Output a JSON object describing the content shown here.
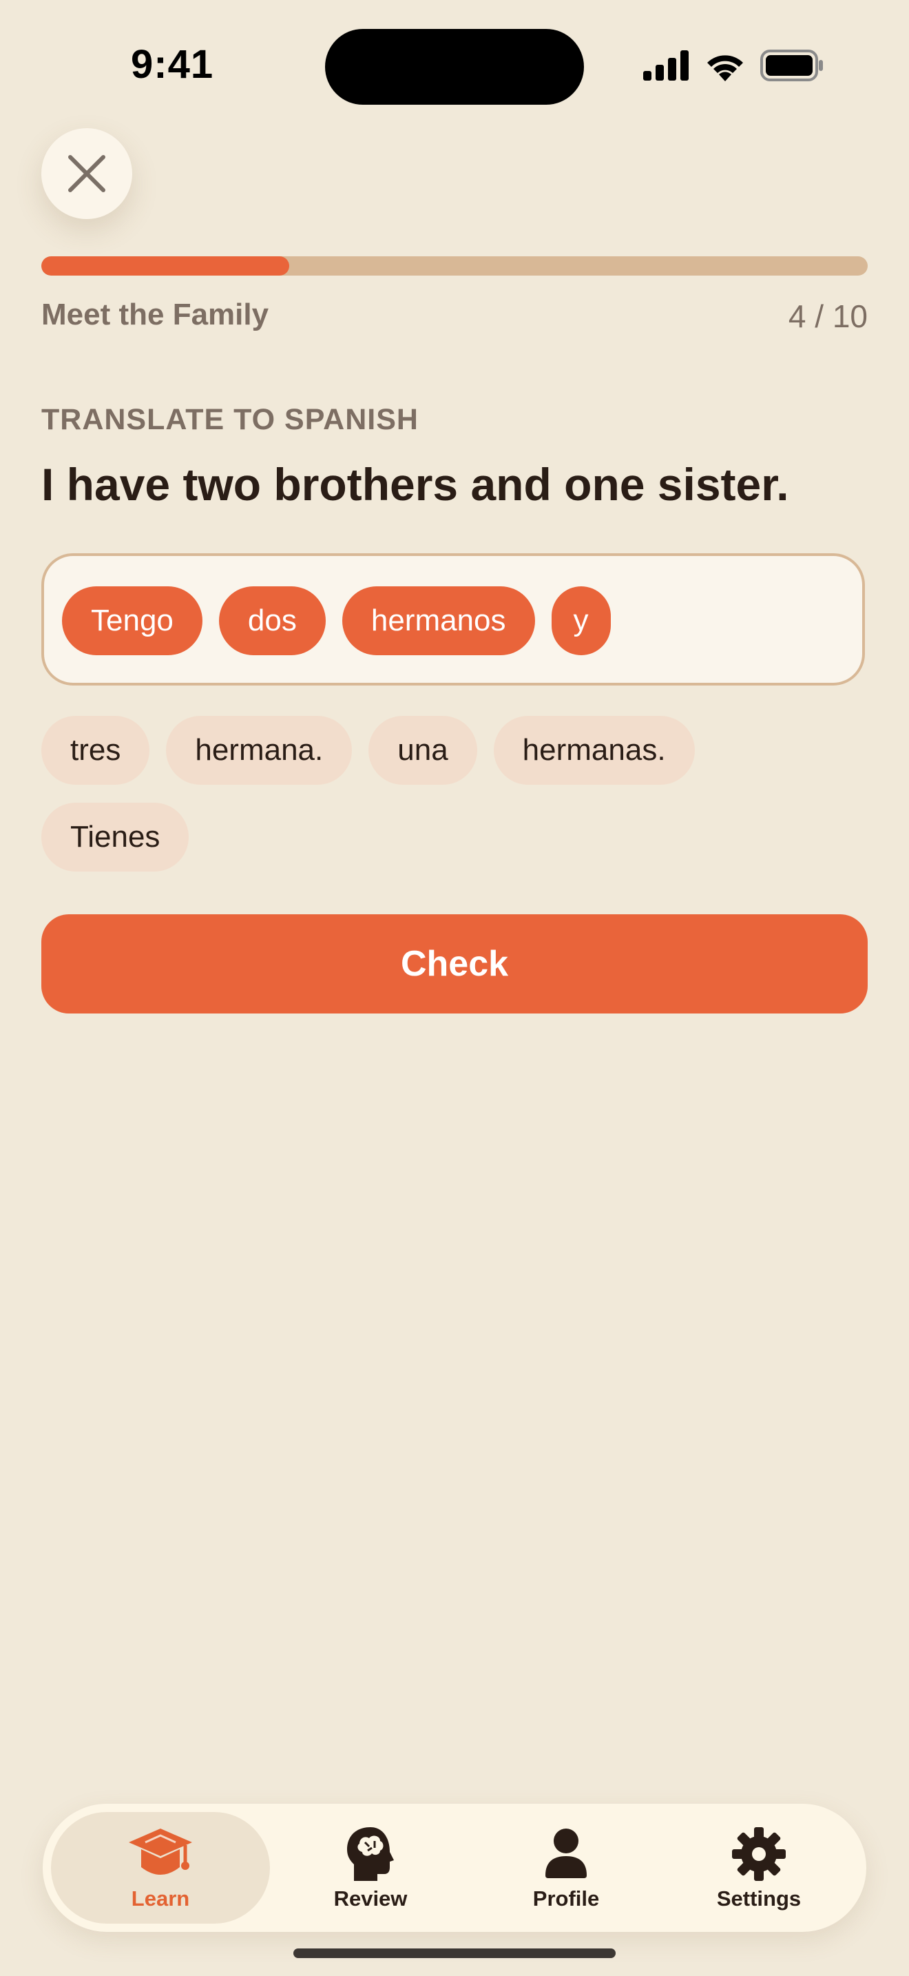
{
  "status_bar": {
    "time": "9:41"
  },
  "lesson": {
    "title": "Meet the Family",
    "count": "4 / 10",
    "progress": 0.3
  },
  "exercise": {
    "label": "TRANSLATE TO SPANISH",
    "prompt": "I have two brothers and one sister."
  },
  "answer_chips": [
    "Tengo",
    "dos",
    "hermanos",
    "y"
  ],
  "word_bank": {
    "row1": [
      "tres",
      "hermana.",
      "una",
      "hermanas."
    ],
    "row2": [
      "Tienes"
    ]
  },
  "check_label": "Check",
  "tabs": [
    {
      "label": "Learn",
      "icon": "graduation-cap-icon",
      "active": true
    },
    {
      "label": "Review",
      "icon": "brain-head-icon",
      "active": false
    },
    {
      "label": "Profile",
      "icon": "person-icon",
      "active": false
    },
    {
      "label": "Settings",
      "icon": "gear-icon",
      "active": false
    }
  ],
  "colors": {
    "accent": "#e9643a",
    "background": "#f1e9d9",
    "track": "#d8b896",
    "chip_bank": "#f2ddcc"
  }
}
